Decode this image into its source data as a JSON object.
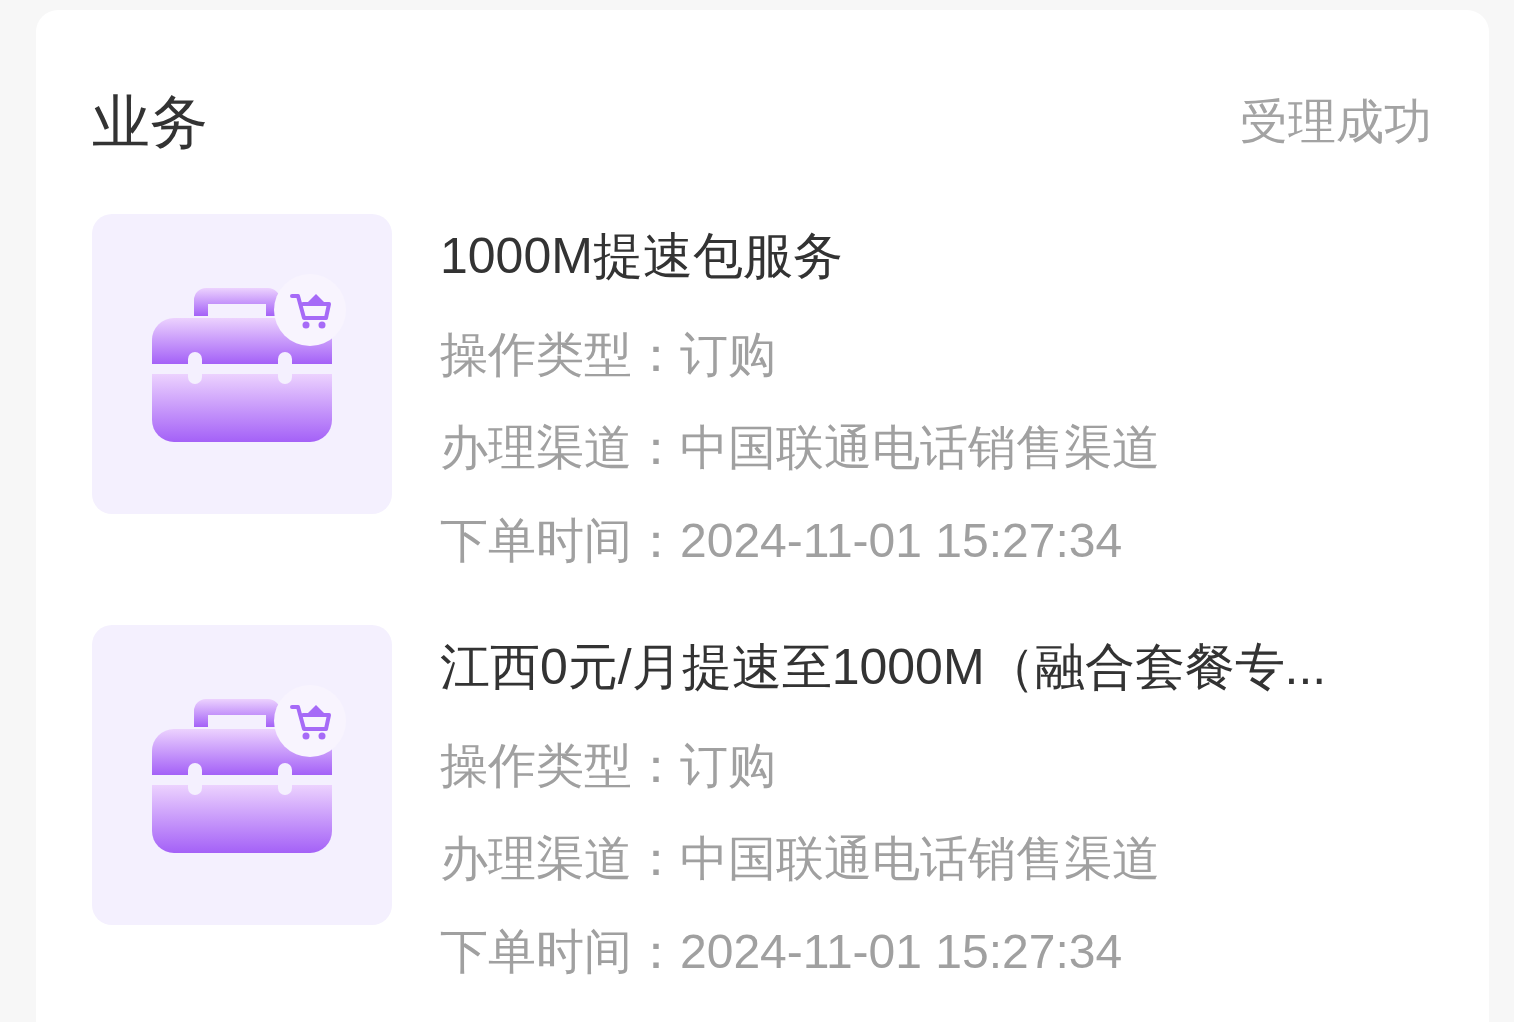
{
  "section": {
    "title": "业务",
    "status": "受理成功"
  },
  "orders": [
    {
      "title": "1000M提速包服务",
      "fields": [
        {
          "label": "操作类型：",
          "value": "订购"
        },
        {
          "label": "办理渠道：",
          "value": "中国联通电话销售渠道"
        },
        {
          "label": "下单时间：",
          "value": "2024-11-01 15:27:34"
        }
      ]
    },
    {
      "title": "江西0元/月提速至1000M（融合套餐专...",
      "fields": [
        {
          "label": "操作类型：",
          "value": "订购"
        },
        {
          "label": "办理渠道：",
          "value": "中国联通电话销售渠道"
        },
        {
          "label": "下单时间：",
          "value": "2024-11-01 15:27:34"
        }
      ]
    }
  ]
}
